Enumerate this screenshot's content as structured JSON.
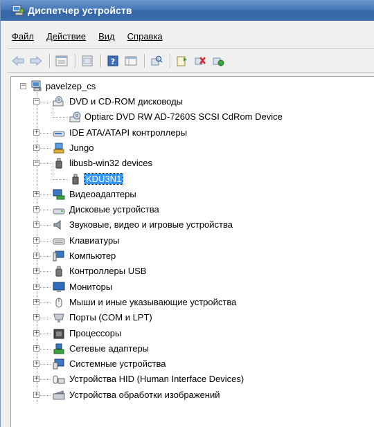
{
  "window": {
    "title": "Диспетчер устройств"
  },
  "menu": [
    {
      "label": "Файл"
    },
    {
      "label": "Действие"
    },
    {
      "label": "Вид"
    },
    {
      "label": "Справка"
    }
  ],
  "toolbar": [
    {
      "name": "back-arrow-icon"
    },
    {
      "name": "forward-arrow-icon"
    },
    {
      "name": "properties-icon"
    },
    {
      "name": "show-hide-icon"
    },
    {
      "name": "help-icon"
    },
    {
      "name": "view-icon"
    },
    {
      "name": "scan-hardware-icon"
    },
    {
      "name": "update-driver-icon"
    },
    {
      "name": "uninstall-icon"
    },
    {
      "name": "enable-device-icon"
    }
  ],
  "tree": {
    "root": "pavelzep_cs",
    "items": [
      {
        "label": "DVD и CD-ROM дисководы",
        "icon": "dvd-drive-icon",
        "expanded": true
      },
      {
        "label": "Optiarc DVD RW AD-7260S SCSI CdRom Device",
        "icon": "dvd-device-icon",
        "child": true
      },
      {
        "label": "IDE ATA/ATAPI контроллеры",
        "icon": "ide-controller-icon"
      },
      {
        "label": "Jungo",
        "icon": "jungo-icon"
      },
      {
        "label": "libusb-win32 devices",
        "icon": "usb-device-icon",
        "expanded": true
      },
      {
        "label": "KDU3N1",
        "icon": "usb-device-icon",
        "child": true,
        "selected": true
      },
      {
        "label": "Видеоадаптеры",
        "icon": "display-adapter-icon"
      },
      {
        "label": "Дисковые устройства",
        "icon": "disk-drive-icon"
      },
      {
        "label": "Звуковые, видео и игровые устройства",
        "icon": "sound-icon"
      },
      {
        "label": "Клавиатуры",
        "icon": "keyboard-icon"
      },
      {
        "label": "Компьютер",
        "icon": "computer-icon"
      },
      {
        "label": "Контроллеры USB",
        "icon": "usb-controller-icon"
      },
      {
        "label": "Мониторы",
        "icon": "monitor-icon"
      },
      {
        "label": "Мыши и иные указывающие устройства",
        "icon": "mouse-icon"
      },
      {
        "label": "Порты (COM и LPT)",
        "icon": "port-icon"
      },
      {
        "label": "Процессоры",
        "icon": "processor-icon"
      },
      {
        "label": "Сетевые адаптеры",
        "icon": "network-adapter-icon"
      },
      {
        "label": "Системные устройства",
        "icon": "system-device-icon"
      },
      {
        "label": "Устройства HID (Human Interface Devices)",
        "icon": "hid-icon"
      },
      {
        "label": "Устройства обработки изображений",
        "icon": "imaging-device-icon"
      }
    ]
  },
  "colors": {
    "titlebar": "#3a6cae",
    "selection": "#3399ff"
  }
}
